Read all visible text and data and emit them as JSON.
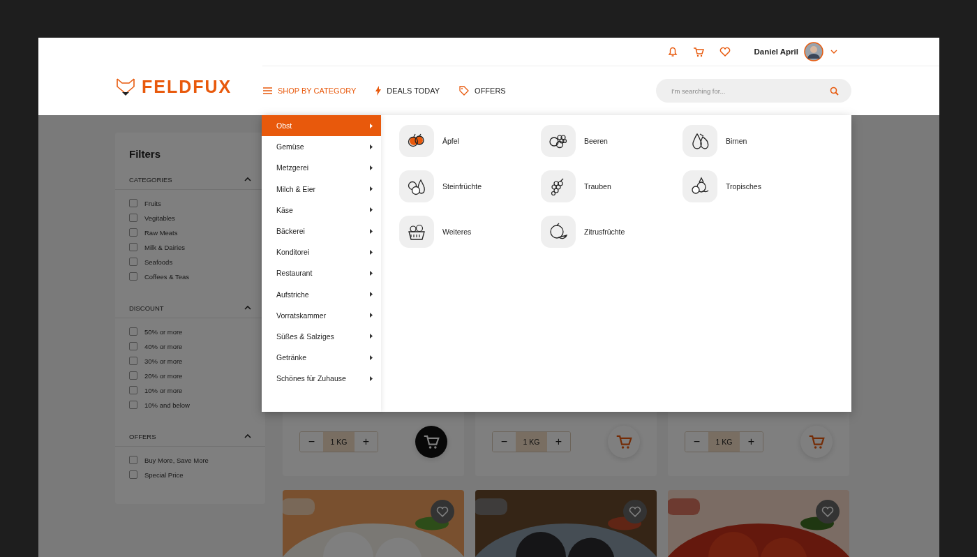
{
  "header": {
    "logo": "FELDFUX",
    "user_name": "Daniel April",
    "search": {
      "placeholder": "I'm searching for..."
    },
    "nav": [
      {
        "label": "SHOP BY CATEGORY",
        "selected": true
      },
      {
        "label": "DEALS TODAY",
        "selected": false
      },
      {
        "label": "OFFERS",
        "selected": false
      }
    ]
  },
  "filters": {
    "title": "Filters",
    "sections": [
      {
        "title": "CATEGORIES",
        "expanded": true,
        "options": [
          {
            "label": "Fruits",
            "checked": false
          },
          {
            "label": "Vegitables",
            "checked": false
          },
          {
            "label": "Raw Meats",
            "checked": false
          },
          {
            "label": "Milk & Dairies",
            "checked": false
          },
          {
            "label": "Seafoods",
            "checked": false
          },
          {
            "label": "Coffees & Teas",
            "checked": false
          }
        ]
      },
      {
        "title": "DISCOUNT",
        "expanded": true,
        "options": [
          {
            "label": "50% or more",
            "checked": false
          },
          {
            "label": "40% or more",
            "checked": false
          },
          {
            "label": "30% or more",
            "checked": false
          },
          {
            "label": "20% or more",
            "checked": false
          },
          {
            "label": "10% or more",
            "checked": false
          },
          {
            "label": "10% and below",
            "checked": false
          }
        ]
      },
      {
        "title": "OFFERS",
        "expanded": true,
        "options": [
          {
            "label": "Buy More, Save More",
            "checked": false
          },
          {
            "label": "Special Price",
            "checked": false
          }
        ]
      }
    ]
  },
  "products": [
    {
      "decrease": "−",
      "quantity": "1 KG",
      "increase": "+",
      "in_cart": true
    },
    {
      "decrease": "−",
      "quantity": "1 KG",
      "increase": "+",
      "in_cart": false
    },
    {
      "decrease": "−",
      "quantity": "1 KG",
      "increase": "+",
      "in_cart": false
    }
  ],
  "category_menu": {
    "categories": [
      {
        "label": "Obst",
        "selected": true
      },
      {
        "label": "Gemüse",
        "selected": false
      },
      {
        "label": "Metzgerei",
        "selected": false
      },
      {
        "label": "Milch & Eier",
        "selected": false
      },
      {
        "label": "Käse",
        "selected": false
      },
      {
        "label": "Bäckerei",
        "selected": false
      },
      {
        "label": "Konditorei",
        "selected": false
      },
      {
        "label": "Restaurant",
        "selected": false
      },
      {
        "label": "Aufstriche",
        "selected": false
      },
      {
        "label": "Vorratskammer",
        "selected": false
      },
      {
        "label": "Süßes & Salziges",
        "selected": false
      },
      {
        "label": "Getränke",
        "selected": false
      },
      {
        "label": "Schönes für Zuhause",
        "selected": false
      }
    ],
    "subcategories": [
      {
        "label": "Äpfel"
      },
      {
        "label": "Beeren"
      },
      {
        "label": "Birnen"
      },
      {
        "label": "Steinfrüchte"
      },
      {
        "label": "Trauben"
      },
      {
        "label": "Tropisches"
      },
      {
        "label": "Weiteres"
      },
      {
        "label": "Zitrusfrüchte"
      }
    ]
  }
}
